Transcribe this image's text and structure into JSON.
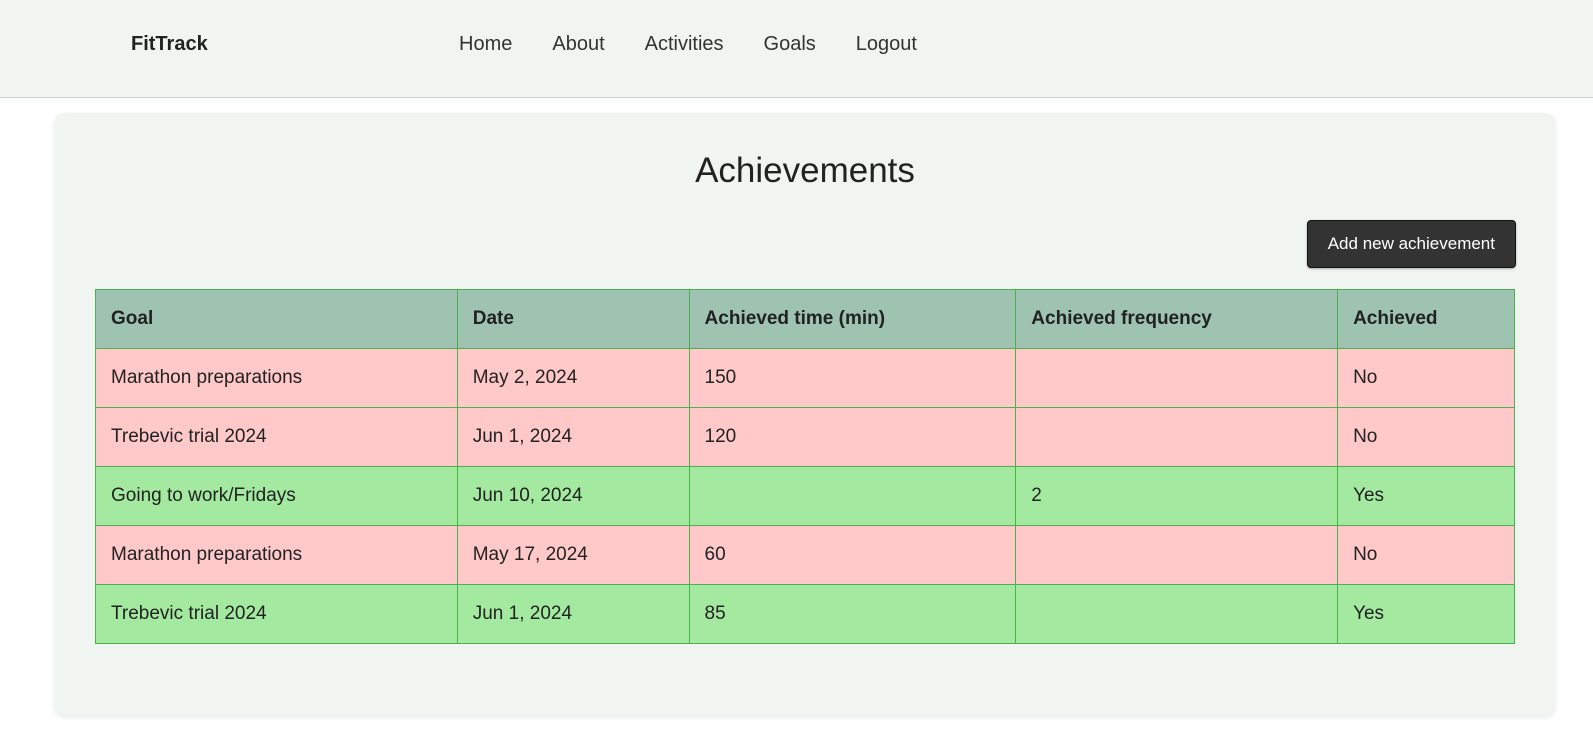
{
  "nav": {
    "brand": "FitTrack",
    "links": [
      "Home",
      "About",
      "Activities",
      "Goals",
      "Logout"
    ]
  },
  "main": {
    "title": "Achievements",
    "add_button_label": "Add new achievement",
    "table": {
      "headers": [
        "Goal",
        "Date",
        "Achieved time (min)",
        "Achieved frequency",
        "Achieved"
      ],
      "rows": [
        {
          "goal": "Marathon preparations",
          "date": "May 2, 2024",
          "time": "150",
          "frequency": "",
          "achieved": "No"
        },
        {
          "goal": "Trebevic trial 2024",
          "date": "Jun 1, 2024",
          "time": "120",
          "frequency": "",
          "achieved": "No"
        },
        {
          "goal": "Going to work/Fridays",
          "date": "Jun 10, 2024",
          "time": "",
          "frequency": "2",
          "achieved": "Yes"
        },
        {
          "goal": "Marathon preparations",
          "date": "May 17, 2024",
          "time": "60",
          "frequency": "",
          "achieved": "No"
        },
        {
          "goal": "Trebevic trial 2024",
          "date": "Jun 1, 2024",
          "time": "85",
          "frequency": "",
          "achieved": "Yes"
        }
      ]
    }
  },
  "colors": {
    "achieved_yes": "#a3e9a0",
    "achieved_no": "#ffc9c9",
    "header_bg": "#9ec4b1",
    "border": "#4caf50"
  }
}
